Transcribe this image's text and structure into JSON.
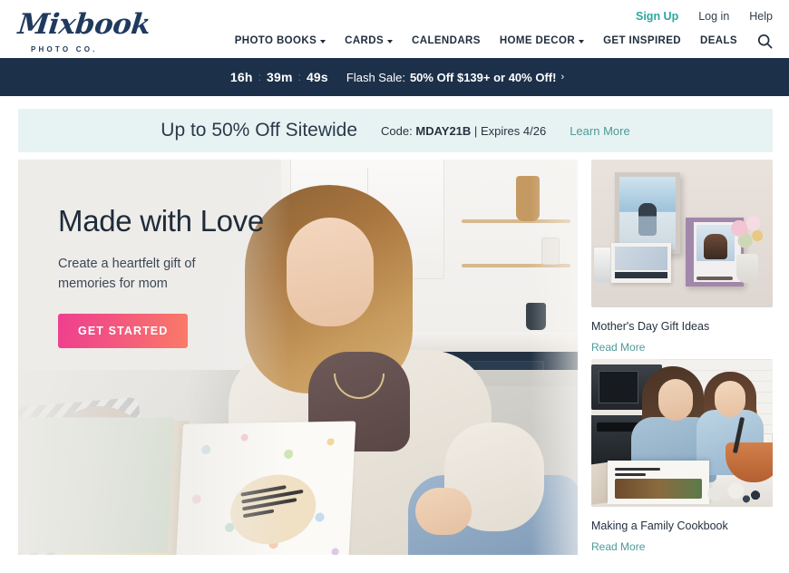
{
  "header": {
    "logo": {
      "word": "Mixbook",
      "subtitle": "PHOTO CO."
    },
    "utility": [
      {
        "label": "Sign Up",
        "accent": true
      },
      {
        "label": "Log in",
        "accent": false
      },
      {
        "label": "Help",
        "accent": false
      }
    ],
    "nav": [
      {
        "label": "PHOTO BOOKS",
        "caret": true
      },
      {
        "label": "CARDS",
        "caret": true
      },
      {
        "label": "CALENDARS",
        "caret": false
      },
      {
        "label": "HOME DECOR",
        "caret": true
      },
      {
        "label": "GET INSPIRED",
        "caret": false
      },
      {
        "label": "DEALS",
        "caret": false
      }
    ],
    "search_icon": "search-icon"
  },
  "flash_banner": {
    "hours": "16h",
    "minutes": "39m",
    "seconds": "49s",
    "separator": ":",
    "prefix": "Flash Sale:",
    "offer": "50% Off $139+ or 40% Off!",
    "arrow": "›",
    "background": "#1c3049"
  },
  "promo_bar": {
    "title": "Up to 50% Off Sitewide",
    "code_prefix": "Code:",
    "code": "MDAY21B",
    "divider": "|",
    "expires": "Expires 4/26",
    "learn_more": "Learn More",
    "background": "#e7f3f3",
    "link_color": "#4d9a99"
  },
  "hero": {
    "title": "Made with Love",
    "subtitle": "Create a heartfelt gift of memories for mom",
    "cta_label": "GET STARTED",
    "cta_gradient_start": "#ef3f8f",
    "cta_gradient_end": "#fa7b66"
  },
  "sidebar_cards": [
    {
      "title": "Mother's Day Gift Ideas",
      "link_label": "Read More",
      "image_alt": "mothers-day-gift-products"
    },
    {
      "title": "Making a Family Cookbook",
      "link_label": "Read More",
      "image_alt": "mother-and-daughter-cooking"
    }
  ],
  "colors": {
    "navy": "#1c3049",
    "teal": "#2ba8a0",
    "link_teal": "#4d9a99",
    "text_dark": "#1f2d3d"
  }
}
